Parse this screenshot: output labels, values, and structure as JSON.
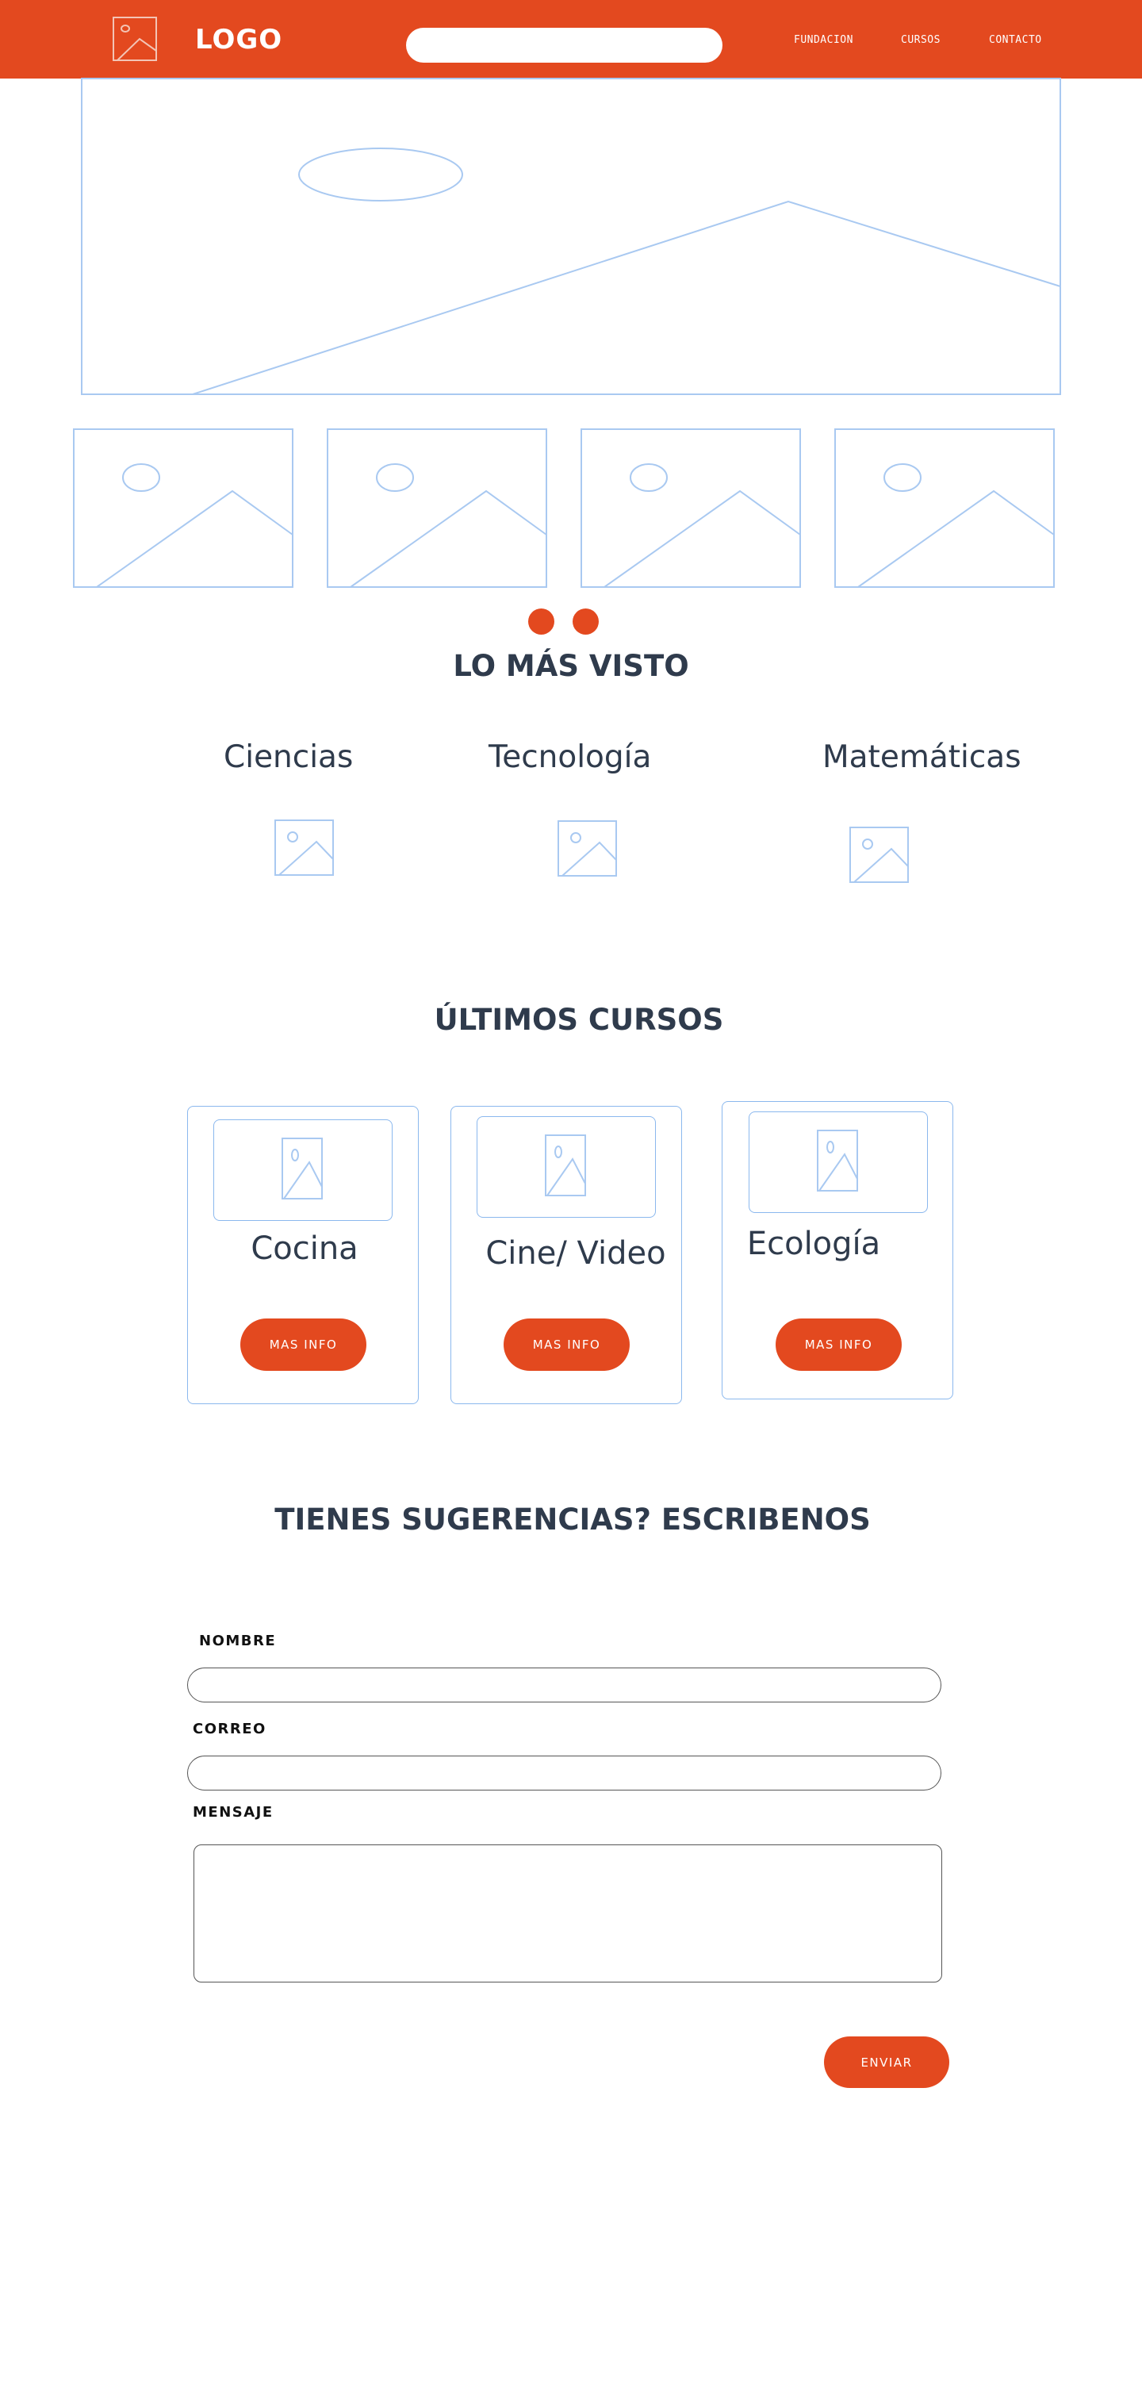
{
  "header": {
    "logo_text": "LOGO",
    "search": {
      "value": "",
      "placeholder": ""
    },
    "nav": [
      "FUNDACION",
      "CURSOS",
      "CONTACTO"
    ]
  },
  "hero": {
    "image": "image-placeholder-icon"
  },
  "gallery": {
    "images": [
      "image-placeholder-icon",
      "image-placeholder-icon",
      "image-placeholder-icon",
      "image-placeholder-icon"
    ]
  },
  "slider": {
    "dots": 2
  },
  "most_viewed": {
    "title": "LO MÁS VISTO",
    "categories": [
      {
        "label": "Ciencias",
        "icon": "image-placeholder-icon"
      },
      {
        "label": "Tecnología",
        "icon": "image-placeholder-icon"
      },
      {
        "label": "Matemáticas",
        "icon": "image-placeholder-icon"
      }
    ]
  },
  "latest_courses": {
    "title": "ÚLTIMOS CURSOS",
    "courses": [
      {
        "title": "Cocina",
        "button": "MAS INFO"
      },
      {
        "title": "Cine/ Video",
        "button": "MAS INFO"
      },
      {
        "title": "Ecología",
        "button": "MAS INFO"
      }
    ]
  },
  "contact": {
    "title": "TIENES SUGERENCIAS? ESCRIBENOS",
    "name_label": "NOMBRE",
    "name_value": "",
    "email_label": "CORREO",
    "email_value": "",
    "message_label": "MENSAJE",
    "message_value": "",
    "submit": "ENVIAR"
  },
  "colors": {
    "accent": "#e3491f",
    "heading": "#2f3b4c",
    "placeholder_stroke": "#8bb8ee",
    "background": "#ffffff"
  }
}
